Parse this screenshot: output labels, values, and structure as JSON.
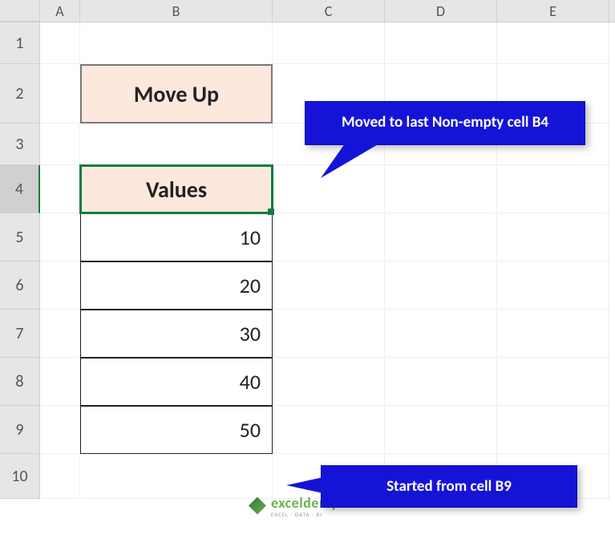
{
  "columns": {
    "A": "A",
    "B": "B",
    "C": "C",
    "D": "D",
    "E": "E"
  },
  "rows": {
    "r1": "1",
    "r2": "2",
    "r3": "3",
    "r4": "4",
    "r5": "5",
    "r6": "6",
    "r7": "7",
    "r8": "8",
    "r9": "9",
    "r10": "10"
  },
  "cells": {
    "B2": "Move Up",
    "B4": "Values",
    "B5": "10",
    "B6": "20",
    "B7": "30",
    "B8": "40",
    "B9": "50"
  },
  "selected_cell": "B4",
  "callouts": {
    "top": "Moved to last Non-empty cell B4",
    "bottom": "Started from cell B9"
  },
  "logo": {
    "name": "exceldemy",
    "tagline": "EXCEL · DATA · BI"
  },
  "chart_data": {
    "type": "table",
    "title": "Move Up",
    "columns": [
      "Values"
    ],
    "rows": [
      [
        10
      ],
      [
        20
      ],
      [
        30
      ],
      [
        40
      ],
      [
        50
      ]
    ]
  }
}
